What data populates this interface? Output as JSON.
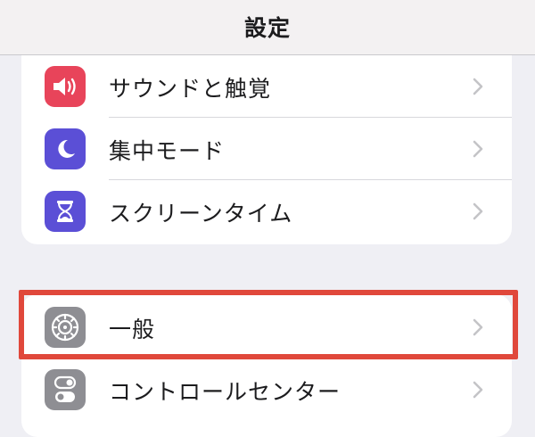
{
  "header": {
    "title": "設定"
  },
  "groups": [
    {
      "items": [
        {
          "label": "サウンドと触覚",
          "icon": "speaker-icon",
          "color": "#e8445a"
        },
        {
          "label": "集中モード",
          "icon": "moon-icon",
          "color": "#5b4fd6"
        },
        {
          "label": "スクリーンタイム",
          "icon": "hourglass-icon",
          "color": "#5b4fd6"
        }
      ]
    },
    {
      "items": [
        {
          "label": "一般",
          "icon": "gear-icon",
          "color": "#8e8e93",
          "highlighted": true
        },
        {
          "label": "コントロールセンター",
          "icon": "toggle-switch-icon",
          "color": "#8e8e93"
        }
      ]
    }
  ],
  "colors": {
    "highlight": "#e0483b",
    "background": "#efeff4",
    "chevron": "#c4c4c7"
  }
}
